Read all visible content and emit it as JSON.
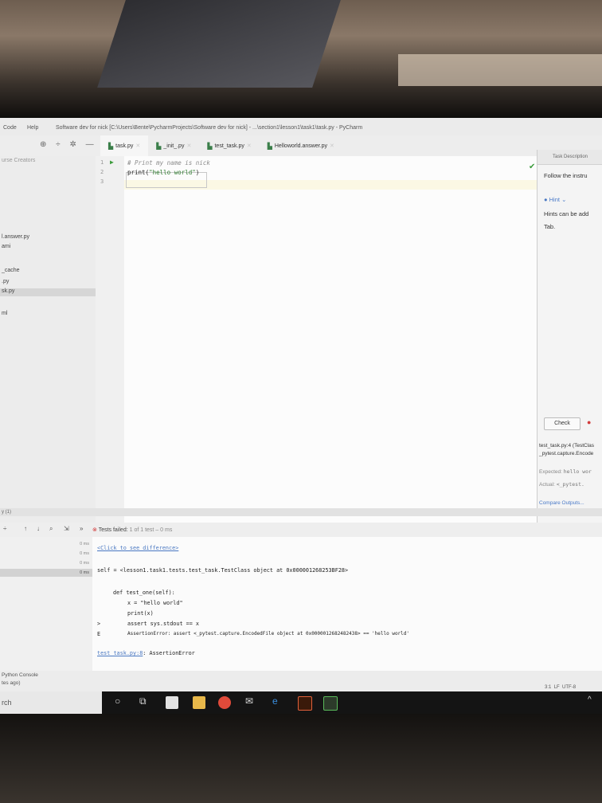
{
  "window": {
    "menu_code": "Code",
    "menu_help": "Help",
    "title": "Software dev for nick [C:\\Users\\Bente\\PycharmProjects\\Software dev for nick] - ...\\section1\\lesson1\\task1\\task.py - PyCharm"
  },
  "tabs": [
    {
      "label": "task.py"
    },
    {
      "label": "_init_.py"
    },
    {
      "label": "test_task.py"
    },
    {
      "label": "Helloworld.answer.py"
    }
  ],
  "project": {
    "header": "urse Creators",
    "items": [
      "l.answer.py",
      "ami",
      "_cache",
      ".py",
      "sk.py",
      "ml"
    ]
  },
  "editor": {
    "line_numbers": [
      "1",
      "2",
      "3"
    ],
    "line1": "# Print my name is nick",
    "line2_fn": "print(",
    "line2_str": "\"hello world\"",
    "line2_end": ")"
  },
  "task_panel": {
    "header": "Task Description",
    "text1": "Follow the instru",
    "hint": "Hint",
    "hint_text1": "Hints can be add",
    "hint_text2": "Tab.",
    "check_label": "Check",
    "result1": "test_task.py:4 (TestClas",
    "result2": "_pytest.capture.Encode",
    "expected_label": "Expected:",
    "expected_value": "hello wor",
    "actual_label": "Actual:",
    "actual_value": "<_pytest.",
    "compare": "Compare Outputs..."
  },
  "run_panel": {
    "tab_label": "y (1)",
    "status_prefix": "Tests failed:",
    "status_detail": "1 of 1 test – 0 ms",
    "times": [
      "0 ms",
      "0 ms",
      "0 ms",
      "0 ms"
    ],
    "console": {
      "diff_link": "<Click to see difference>",
      "self_line": "self = <lesson1.task1.tests.test_task.TestClass object at 0x000001268253BF28>",
      "def_line": "def test_one(self):",
      "x_line": "x = \"hello world\"",
      "print_line": "print(x)",
      "assert_marker": ">",
      "assert_line": "assert sys.stdout == x",
      "err_marker": "E",
      "err_line": "AssertionError: assert <_pytest.capture.EncodedFile object at 0x0000012682482438> == 'hello world'",
      "trace_link": "test_task.py:8",
      "trace_rest": ": AssertionError"
    }
  },
  "status_bar": {
    "python_console": "Python Console",
    "ago": "tes ago)",
    "position": "3:1",
    "line_sep": "LF",
    "encoding": "UTF-8"
  },
  "taskbar": {
    "search_text": "rch"
  },
  "colors": {
    "accent": "#4a78c2",
    "error": "#d23b3b",
    "success": "#3c9c3c"
  }
}
